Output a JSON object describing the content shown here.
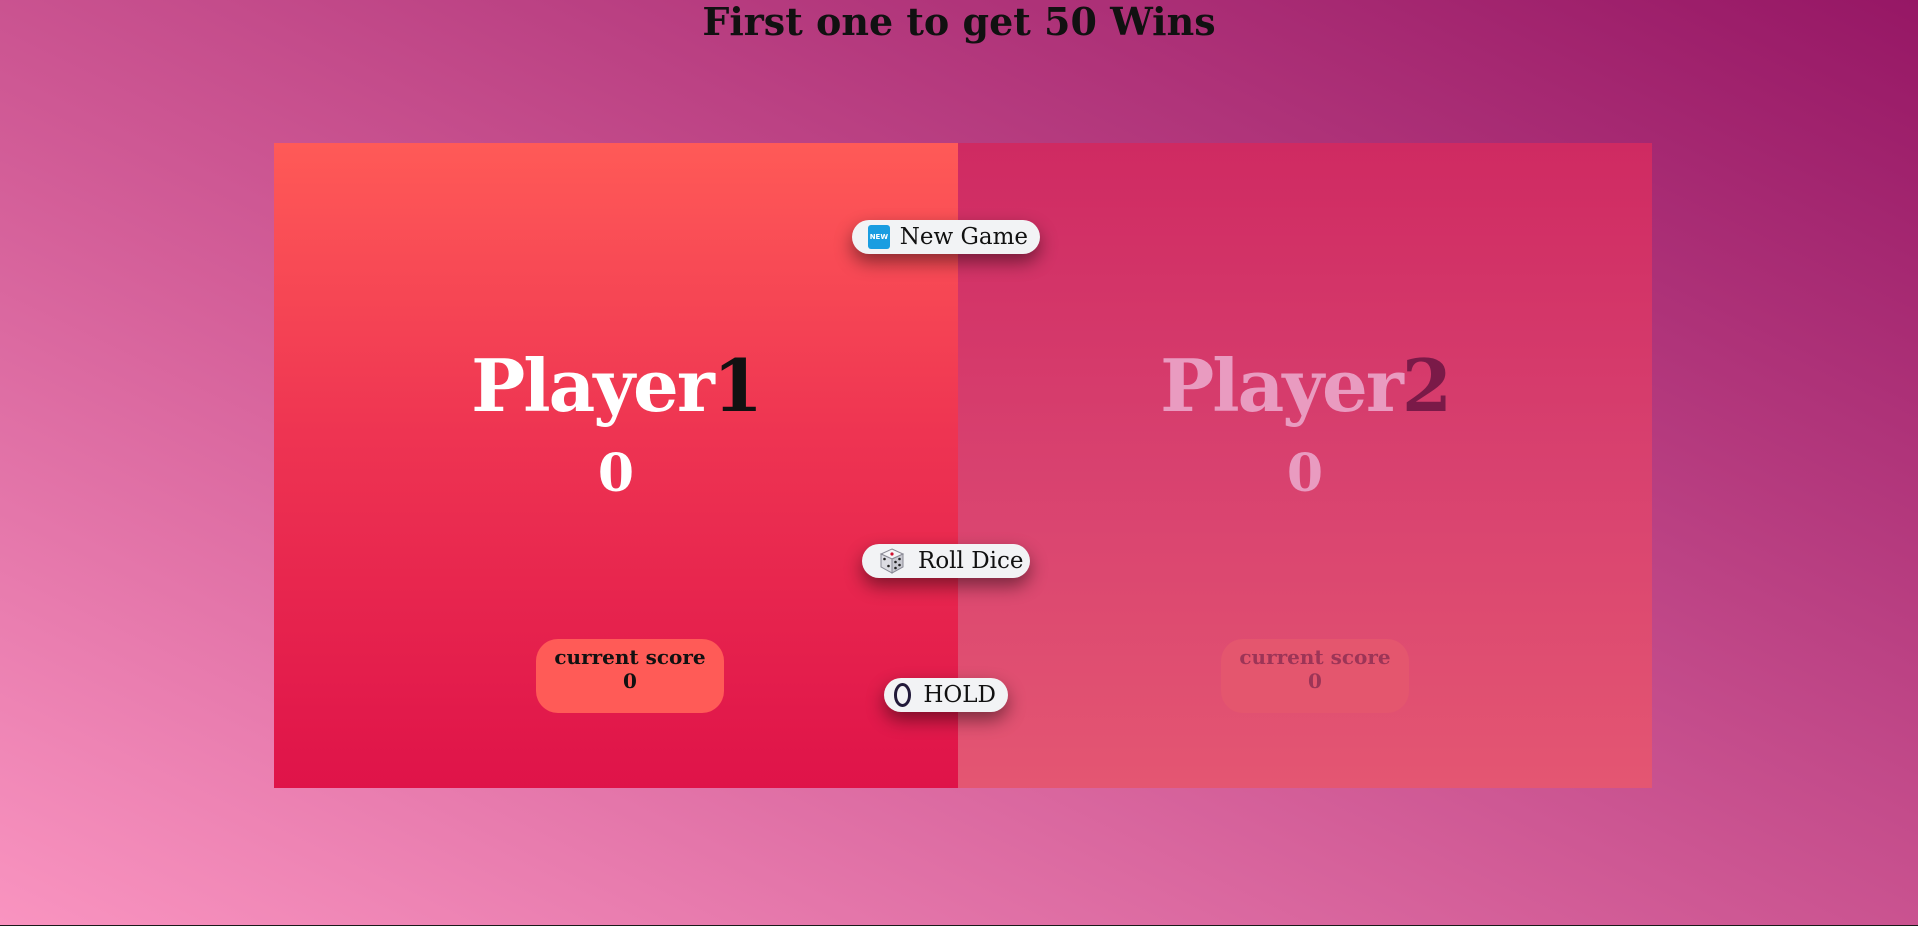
{
  "title": "First one to get 50 Wins",
  "players": [
    {
      "name": "Player",
      "number": "1",
      "score": "0",
      "current_label": "current score",
      "current_score": "0",
      "active": true
    },
    {
      "name": "Player",
      "number": "2",
      "score": "0",
      "current_label": "current score",
      "current_score": "0",
      "active": false
    }
  ],
  "buttons": {
    "new_game": {
      "label": "New Game",
      "icon": "new-icon"
    },
    "roll_dice": {
      "label": "Roll Dice",
      "icon": "dice-icon"
    },
    "hold": {
      "label": "HOLD",
      "icon": "circle-icon"
    }
  },
  "colors": {
    "active_panel": "#ff5a57",
    "inactive_panel": "#cf2a62",
    "button_bg": "#f2f3f5"
  }
}
